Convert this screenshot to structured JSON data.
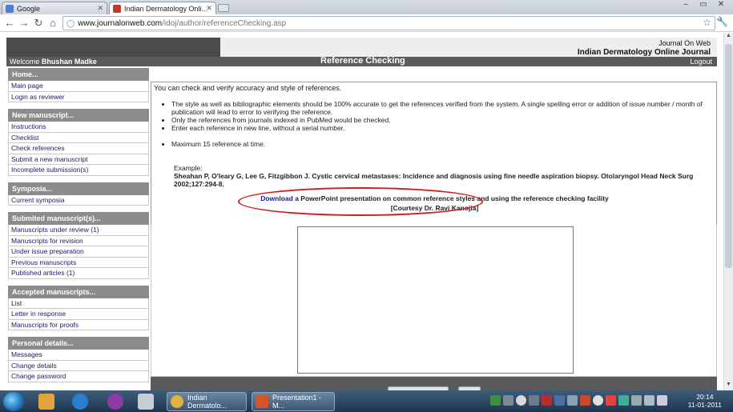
{
  "browser": {
    "tabs": [
      {
        "label": "Google",
        "active": false,
        "favicon_color": "#4a7fd6"
      },
      {
        "label": "Indian Dermatology Onli...",
        "active": true,
        "favicon_color": "#c0392b"
      }
    ],
    "url_host": "www.journalonweb.com",
    "url_path": "/idoj/author/referenceChecking.asp"
  },
  "header": {
    "journal_on_web": "Journal On Web",
    "journal_name": "Indian Dermatology Online Journal",
    "welcome_prefix": "Welcome",
    "user_name": "Bhushan Madke",
    "page_title": "Reference Checking",
    "logout": "Logout"
  },
  "sidebar": {
    "sections": [
      {
        "title": "Home...",
        "items": [
          "Main page",
          "Login as reviewer"
        ]
      },
      {
        "title": "New manuscript...",
        "items": [
          "Instructions",
          "Checklist",
          "Check references",
          "Submit a new manuscript",
          "Incomplete submission(s)"
        ]
      },
      {
        "title": "Symposia...",
        "items": [
          "Current symposia"
        ]
      },
      {
        "title": "Submited manuscript(s)...",
        "items": [
          "Manuscripts under review (1)",
          "Manuscripts for revision",
          "Under issue preparation",
          "Previous manuscripts",
          "Published articles (1)"
        ]
      },
      {
        "title": "Accepted manuscripts...",
        "items": [
          "List",
          "Letter in response",
          "Manuscripts for proofs"
        ]
      },
      {
        "title": "Personal details...",
        "items": [
          "Messages",
          "Change details",
          "Change password"
        ]
      }
    ]
  },
  "content": {
    "intro": "You can check and verify accuracy and style of references.",
    "bullets": [
      "The style as well as bibliographic elements should be 100% accurate to get the references verified from the system. A single spelling error or addition of issue number / month of publication will lead to error to verifying the reference.",
      "Only the references from journals indexed in PubMed would be checked.",
      "Enter each reference in new line, without a serial number."
    ],
    "max_refs": "Maximum 15 reference at time.",
    "example_label": "Example:",
    "example_text": "Sheahan P, O'leary G, Lee G, Fitzgibbon J. Cystic cervical metastases: Incidence and diagnosis using fine needle aspiration biopsy. Otolaryngol Head Neck Surg 2002;127:294-8.",
    "download_link": "Download",
    "download_rest": " a PowerPoint presentation on common reference styles and using the reference checking facility",
    "courtesy": "[Courtesy Dr. Ravi Kanojia]",
    "highlight_color": "#d01d1d"
  },
  "taskbar": {
    "buttons": [
      {
        "label": "Indian Dermatolo...",
        "icon_color": "#e3b23c"
      },
      {
        "label": "Presentation1 - M...",
        "icon_color": "#d4552a"
      }
    ],
    "time": "20:14",
    "date": "11-01-2011"
  }
}
